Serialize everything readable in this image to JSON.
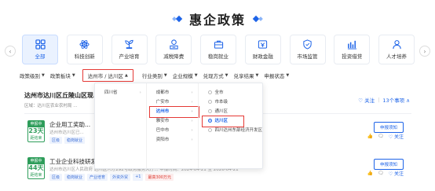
{
  "title": "惠企政策",
  "categories": [
    {
      "label": "全部",
      "icon": "grid-icon",
      "active": true
    },
    {
      "label": "科技创新",
      "icon": "atom-icon"
    },
    {
      "label": "产业培育",
      "icon": "plant-icon"
    },
    {
      "label": "减税降费",
      "icon": "tax-icon"
    },
    {
      "label": "稳岗就业",
      "icon": "briefcase-icon"
    },
    {
      "label": "财政金融",
      "icon": "finance-icon"
    },
    {
      "label": "市场监管",
      "icon": "shield-icon"
    },
    {
      "label": "投资借贷",
      "icon": "bank-icon"
    },
    {
      "label": "人才培养",
      "icon": "person-icon"
    }
  ],
  "filters": {
    "level": "政策级别",
    "block": "政策板块",
    "region": "达州市 / 达川区",
    "industry": "行业类别",
    "scale": "企业规模",
    "method": "兑现方式",
    "result": "兑享结果",
    "status": "申报状态"
  },
  "card": {
    "title": "达州市达川区丘陵山区现...",
    "subtitle": "区域：达川区农业农村局 ...",
    "follow": "♡ 关注",
    "count": "13个事项 ∧"
  },
  "items": [
    {
      "status": "申报中",
      "days": "23天",
      "deadline": "距结束",
      "title": "企业用工奖助...",
      "meta": "达州市达川区已...",
      "tags": [
        "区级",
        "稳岗就业"
      ],
      "button": "申报须知",
      "follow": "♡ 关注"
    },
    {
      "status": "申报中",
      "days": "44天",
      "deadline": "距结束",
      "title": "工业企业科技研发奖励",
      "meta": "达州市达川区人民政府 达川区人才292号政务服务大厅...  申报时间：2024-04-21 至 2026-04-21",
      "tags": [
        "区级",
        "稳岗就业",
        "产业培育",
        "外资外贸",
        "+1",
        "最高300万元"
      ],
      "button": "申报须知",
      "follow": "♡ 关注"
    }
  ],
  "dropdown": {
    "col1": [
      "四川省"
    ],
    "col2": [
      "成都市",
      "广安市",
      "达州市",
      "雅安市",
      "巴中市",
      "资阳市"
    ],
    "col3": [
      "全市",
      "市本级",
      "通川区",
      "达川区",
      "四川达州东部经济开发区"
    ],
    "selected_city": "达州市",
    "selected_district": "达川区"
  },
  "colors": {
    "accent": "#1e64e8",
    "highlight": "#e53935",
    "status": "#2e9d5a"
  }
}
